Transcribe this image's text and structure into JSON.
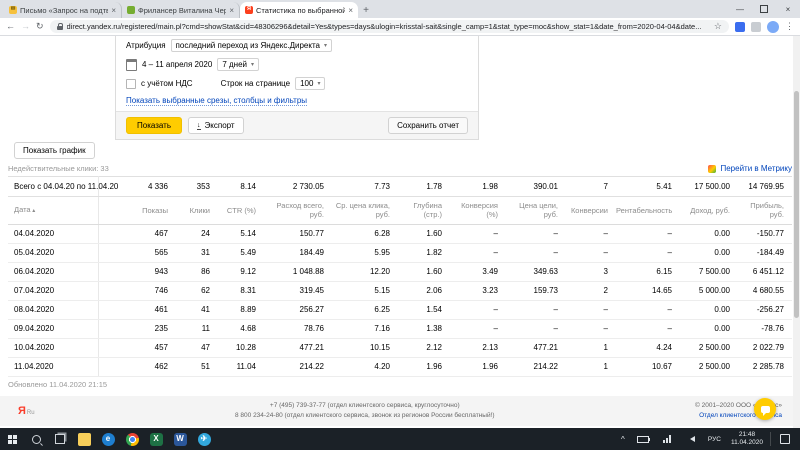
{
  "browser": {
    "tabs": [
      {
        "title": "Письмо «Запрос на подтвер...",
        "icon": "yandex-mail-favicon",
        "color": "#f6c13d",
        "glyph": "✉",
        "glyph_color": "#6b5200",
        "active": false
      },
      {
        "title": "Фрилансер Виталина Черепан...",
        "icon": "fl-ru-favicon",
        "color": "#76ad31",
        "glyph": "",
        "glyph_color": "#ffffff",
        "active": false
      },
      {
        "title": "Статистика по выбранной кам...",
        "icon": "yandex-direct-favicon",
        "color": "#fc3f1d",
        "glyph": "Я",
        "glyph_color": "#ffffff",
        "active": true
      }
    ],
    "url": "direct.yandex.ru/registered/main.pl?cmd=showStat&cid=48306296&detail=Yes&types=days&ulogin=krisstal-sait&single_camp=1&stat_type=moc&show_stat=1&date_from=2020-04-04&date..."
  },
  "filters": {
    "attribution_label": "Атрибуция",
    "attribution_value": "последний переход из Яндекс.Директа",
    "date_range": "4 – 11 апреля 2020",
    "period_preset": "7 дней",
    "vat_checkbox_label": "с учётом НДС",
    "rows_per_page_label": "Строк на странице",
    "rows_per_page_value": "100",
    "customize_link": "Показать выбранные срезы, столбцы и фильтры",
    "show_button": "Показать",
    "export_button": "Экспорт",
    "save_report_button": "Сохранить отчет"
  },
  "toolbar": {
    "show_chart_button": "Показать график",
    "invalid_clicks": "Недействительные клики: 33",
    "metrika_link": "Перейти в Метрику"
  },
  "table": {
    "columns": [
      "Дата",
      "Показы",
      "Клики",
      "CTR (%)",
      "Расход всего, руб.",
      "Ср. цена клика, руб.",
      "Глубина (стр.)",
      "Конверсия (%)",
      "Цена цели, руб.",
      "Конверсии",
      "Рентабельность",
      "Доход, руб.",
      "Прибыль, руб."
    ],
    "summary": {
      "label": "Всего с 04.04.20 по 11.04.20",
      "values": [
        "4 336",
        "353",
        "8.14",
        "2 730.05",
        "7.73",
        "1.78",
        "1.98",
        "390.01",
        "7",
        "5.41",
        "17 500.00",
        "14 769.95"
      ]
    },
    "rows": [
      [
        "04.04.2020",
        "467",
        "24",
        "5.14",
        "150.77",
        "6.28",
        "1.60",
        "–",
        "–",
        "–",
        "–",
        "0.00",
        "-150.77"
      ],
      [
        "05.04.2020",
        "565",
        "31",
        "5.49",
        "184.49",
        "5.95",
        "1.82",
        "–",
        "–",
        "–",
        "–",
        "0.00",
        "-184.49"
      ],
      [
        "06.04.2020",
        "943",
        "86",
        "9.12",
        "1 048.88",
        "12.20",
        "1.60",
        "3.49",
        "349.63",
        "3",
        "6.15",
        "7 500.00",
        "6 451.12"
      ],
      [
        "07.04.2020",
        "746",
        "62",
        "8.31",
        "319.45",
        "5.15",
        "2.06",
        "3.23",
        "159.73",
        "2",
        "14.65",
        "5 000.00",
        "4 680.55"
      ],
      [
        "08.04.2020",
        "461",
        "41",
        "8.89",
        "256.27",
        "6.25",
        "1.54",
        "–",
        "–",
        "–",
        "–",
        "0.00",
        "-256.27"
      ],
      [
        "09.04.2020",
        "235",
        "11",
        "4.68",
        "78.76",
        "7.16",
        "1.38",
        "–",
        "–",
        "–",
        "–",
        "0.00",
        "-78.76"
      ],
      [
        "10.04.2020",
        "457",
        "47",
        "10.28",
        "477.21",
        "10.15",
        "2.12",
        "2.13",
        "477.21",
        "1",
        "4.24",
        "2 500.00",
        "2 022.79"
      ],
      [
        "11.04.2020",
        "462",
        "51",
        "11.04",
        "214.22",
        "4.20",
        "1.96",
        "1.96",
        "214.22",
        "1",
        "10.67",
        "2 500.00",
        "2 285.78"
      ]
    ],
    "updated": "Обновлено 11.04.2020 21:15"
  },
  "page_footer": {
    "logo": "Я",
    "logo_region": "Ru",
    "phone1": "+7 (495) 739-37-77 (отдел клиентского сервиса, круглосуточно)",
    "phone2": "8 800 234-24-80 (отдел клиентского сервиса, звонок из регионов России бесплатный!)",
    "copyright": "© 2001–2020 ООО «Яндекс»",
    "support_link": "Отдел клиентского сервиса"
  },
  "taskbar": {
    "apps": [
      {
        "name": "file-explorer-icon",
        "bg": "#f8cf5a",
        "glyph": "",
        "glyph_color": "#fff",
        "shape": "folder"
      },
      {
        "name": "edge-icon",
        "bg": "#1e7fd0",
        "glyph": "e",
        "glyph_color": "#fff",
        "shape": "circle"
      },
      {
        "name": "chrome-icon",
        "bg": "chrome",
        "glyph": "",
        "glyph_color": "#fff",
        "shape": "circle"
      },
      {
        "name": "excel-icon",
        "bg": "#1e7145",
        "glyph": "X",
        "glyph_color": "#fff",
        "shape": "square"
      },
      {
        "name": "word-icon",
        "bg": "#2b579a",
        "glyph": "W",
        "glyph_color": "#fff",
        "shape": "square"
      },
      {
        "name": "telegram-icon",
        "bg": "#32a8dd",
        "glyph": "✈",
        "glyph_color": "#fff",
        "shape": "circle"
      }
    ],
    "lang": "РУС",
    "time": "21:48",
    "date": "11.04.2020"
  }
}
